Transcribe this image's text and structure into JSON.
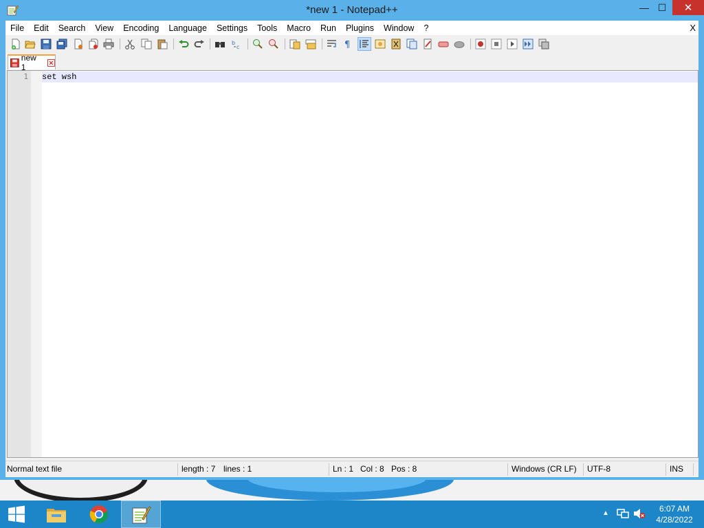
{
  "window": {
    "title": "*new 1 - Notepad++",
    "min_glyph": "—",
    "max_glyph": "☐",
    "close_glyph": "✕"
  },
  "menu": {
    "items": [
      "File",
      "Edit",
      "Search",
      "View",
      "Encoding",
      "Language",
      "Settings",
      "Tools",
      "Macro",
      "Run",
      "Plugins",
      "Window",
      "?"
    ],
    "close": "X"
  },
  "toolbar": {
    "icons": [
      "new-file-icon",
      "open-file-icon",
      "save-icon",
      "save-all-icon",
      "close-icon",
      "close-all-icon",
      "print-icon",
      "cut-icon",
      "copy-icon",
      "paste-icon",
      "undo-icon",
      "redo-icon",
      "find-icon",
      "replace-icon",
      "zoom-in-icon",
      "zoom-out-icon",
      "sync-vertical-icon",
      "sync-horizontal-icon",
      "word-wrap-icon",
      "show-all-characters-icon",
      "indent-guide-icon",
      "user-defined-language-icon",
      "doc-map-icon",
      "function-list-icon",
      "folder-as-workspace-icon",
      "monitoring-icon",
      "record-macro-icon",
      "stop-macro-icon",
      "play-macro-icon",
      "run-macro-multiple-icon",
      "save-macro-icon"
    ]
  },
  "tab": {
    "label": "new 1"
  },
  "editor": {
    "lines": [
      {
        "number": "1",
        "text": "set wsh"
      }
    ]
  },
  "status": {
    "file_type": "Normal text file",
    "length": "length : 7",
    "lines": "lines : 1",
    "ln": "Ln : 1",
    "col": "Col : 8",
    "pos": "Pos : 8",
    "eol": "Windows (CR LF)",
    "encoding": "UTF-8",
    "mode": "INS"
  },
  "taskbar": {
    "time": "6:07 AM",
    "date": "4/28/2022",
    "pinned": [
      "start-icon",
      "file-explorer-icon",
      "chrome-icon",
      "notepad-plus-plus-icon"
    ]
  },
  "colors": {
    "title_bar": "#5ab0e8",
    "close_button": "#c7322c",
    "taskbar": "#1d86c9",
    "current_line": "#e8e8ff",
    "tab_accent": "#f7a43b"
  }
}
